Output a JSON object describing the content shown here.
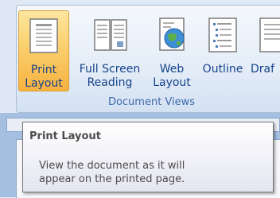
{
  "ribbon": {
    "buttons": [
      {
        "label_line1": "Print",
        "label_line2": "Layout",
        "icon": "print-layout-icon",
        "state": "active"
      },
      {
        "label_line1": "Full Screen",
        "label_line2": "Reading",
        "icon": "full-screen-reading-icon"
      },
      {
        "label_line1": "Web",
        "label_line2": "Layout",
        "icon": "web-layout-icon"
      },
      {
        "label_line1": "Outline",
        "label_line2": "",
        "icon": "outline-icon"
      },
      {
        "label_line1": "Draf",
        "label_line2": "",
        "icon": "draft-icon"
      }
    ],
    "group_label": "Document Views"
  },
  "tooltip": {
    "title": "Print Layout",
    "line1": "View the document as it will",
    "line2": "appear on the printed page."
  },
  "colors": {
    "active_button": "#fbd272",
    "ribbon_text": "#15428b",
    "group_label": "#3e6aaa",
    "tooltip_text": "#4c4c4c"
  }
}
